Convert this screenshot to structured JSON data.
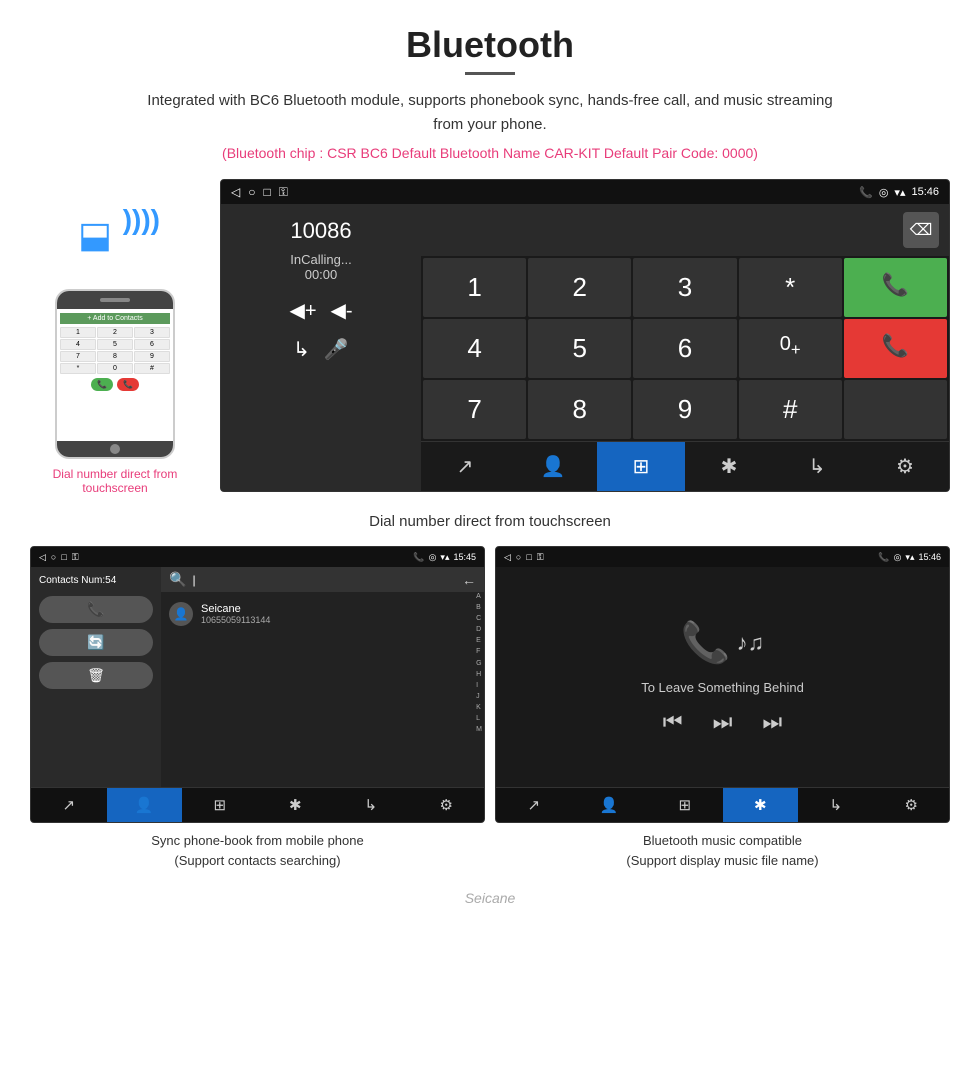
{
  "header": {
    "title": "Bluetooth",
    "description": "Integrated with BC6 Bluetooth module, supports phonebook sync, hands-free call, and music streaming from your phone.",
    "specs": "(Bluetooth chip : CSR BC6    Default Bluetooth Name CAR-KIT    Default Pair Code: 0000)"
  },
  "dial_screen": {
    "status_bar": {
      "time": "15:46",
      "left_icons": [
        "◁",
        "○",
        "□",
        "📶"
      ],
      "right_icons": [
        "📞",
        "📍",
        "📶"
      ]
    },
    "number": "10086",
    "call_status": "InCalling...",
    "call_timer": "00:00",
    "vol_up": "◀+",
    "vol_down": "◀-",
    "transfer_icon": "↳",
    "mic_icon": "🎤",
    "keypad": [
      "1",
      "2",
      "3",
      "*",
      "4",
      "5",
      "6",
      "0+",
      "7",
      "8",
      "9",
      "#"
    ],
    "call_accept_icon": "📞",
    "call_reject_icon": "📞",
    "bottom_bar": [
      "↗📞",
      "👤",
      "⊞",
      "✱",
      "↳",
      "⚙"
    ],
    "caption": "Dial number direct from touchscreen"
  },
  "phonebook_screen": {
    "status_bar": {
      "time": "15:45",
      "left_icons": [
        "◁",
        "○",
        "□",
        "📶"
      ],
      "right_icons": [
        "📞",
        "📍",
        "📶"
      ]
    },
    "contacts_num": "Contacts Num:54",
    "action_buttons": [
      "📞",
      "🔄",
      "🗑"
    ],
    "search_placeholder": "",
    "contact": {
      "name": "Seicane",
      "number": "10655059113144"
    },
    "alpha_list": [
      "A",
      "B",
      "C",
      "D",
      "E",
      "F",
      "G",
      "H",
      "I",
      "J",
      "K",
      "L",
      "M"
    ],
    "bottom_bar_active": 1,
    "caption_line1": "Sync phone-book from mobile phone",
    "caption_line2": "(Support contacts searching)"
  },
  "music_screen": {
    "status_bar": {
      "time": "15:46",
      "left_icons": [
        "◁",
        "○",
        "□",
        "📶"
      ],
      "right_icons": [
        "📞",
        "📍",
        "📶"
      ]
    },
    "track_name": "To Leave Something Behind",
    "controls": [
      "⏮",
      "⏭",
      "⏭"
    ],
    "bottom_bar_active": 3,
    "caption_line1": "Bluetooth music compatible",
    "caption_line2": "(Support display music file name)"
  },
  "watermark": "Seicane"
}
